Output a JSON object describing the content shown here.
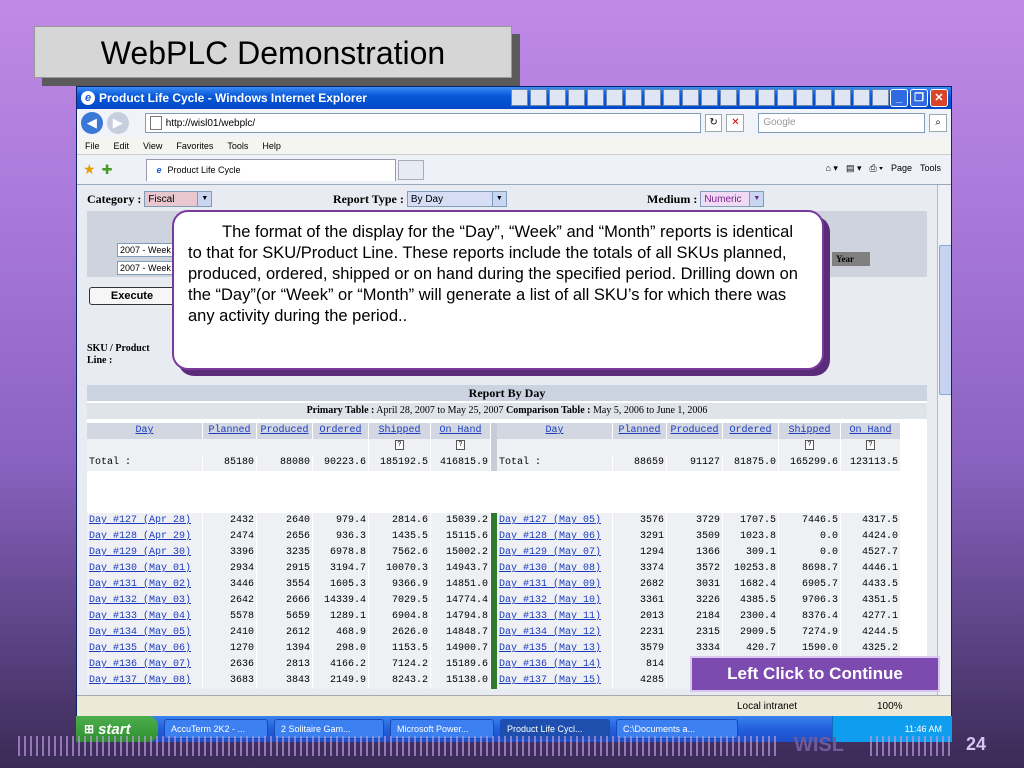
{
  "slide": {
    "title": "WebPLC Demonstration",
    "continue": "Left Click to Continue",
    "brand": "WISL",
    "page": "24"
  },
  "browser": {
    "title": "Product Life Cycle - Windows Internet Explorer",
    "url": "http://wisl01/webplc/",
    "search_placeholder": "Google",
    "menu": [
      "File",
      "Edit",
      "View",
      "Favorites",
      "Tools",
      "Help"
    ],
    "tab": "Product Life Cycle",
    "tools": [
      "Page",
      "Tools"
    ],
    "status_zone": "Local intranet",
    "zoom": "100%"
  },
  "filters": {
    "category_label": "Category :",
    "category_value": "Fiscal",
    "report_label": "Report Type :",
    "report_value": "By Day",
    "medium_label": "Medium :",
    "medium_value": "Numeric",
    "year_label": "Year",
    "week1": "2007 - Week 1",
    "week2": "2007 - Week 2",
    "execute": "Execute",
    "sku_label": "SKU / Product Line :"
  },
  "callout": "The format of the display for the “Day”, “Week” and “Month” reports is identical to that for SKU/Product Line. These reports include the totals of all SKUs planned, produced, ordered, shipped or on hand during the specified period. Drilling down on the “Day”(or “Week” or “Month” will generate a list of all SKU’s for which there was any activity during the period..",
  "report": {
    "title": "Report By Day",
    "primary_label": "Primary Table :",
    "primary_range": "April 28, 2007 to May 25, 2007",
    "comparison_label": "Comparison Table :",
    "comparison_range": "May 5, 2006 to June 1, 2006",
    "columns": [
      "Day",
      "Planned",
      "Produced",
      "Ordered",
      "Shipped",
      "On Hand"
    ],
    "total_left": [
      "Total :",
      "85180",
      "88080",
      "90223.6",
      "185192.5",
      "416815.9"
    ],
    "total_right": [
      "Total :",
      "88659",
      "91127",
      "81875.0",
      "165299.6",
      "123113.5"
    ],
    "rows": [
      [
        [
          "Day #127 (Apr 28)",
          "2432",
          "2640",
          "979.4",
          "2814.6",
          "15039.2"
        ],
        [
          "Day #127 (May 05)",
          "3576",
          "3729",
          "1707.5",
          "7446.5",
          "4317.5"
        ]
      ],
      [
        [
          "Day #128 (Apr 29)",
          "2474",
          "2656",
          "936.3",
          "1435.5",
          "15115.6"
        ],
        [
          "Day #128 (May 06)",
          "3291",
          "3509",
          "1023.8",
          "0.0",
          "4424.0"
        ]
      ],
      [
        [
          "Day #129 (Apr 30)",
          "3396",
          "3235",
          "6978.8",
          "7562.6",
          "15002.2"
        ],
        [
          "Day #129 (May 07)",
          "1294",
          "1366",
          "309.1",
          "0.0",
          "4527.7"
        ]
      ],
      [
        [
          "Day #130 (May 01)",
          "2934",
          "2915",
          "3194.7",
          "10070.3",
          "14943.7"
        ],
        [
          "Day #130 (May 08)",
          "3374",
          "3572",
          "10253.8",
          "8698.7",
          "4446.1"
        ]
      ],
      [
        [
          "Day #131 (May 02)",
          "3446",
          "3554",
          "1605.3",
          "9366.9",
          "14851.0"
        ],
        [
          "Day #131 (May 09)",
          "2682",
          "3031",
          "1682.4",
          "6905.7",
          "4433.5"
        ]
      ],
      [
        [
          "Day #132 (May 03)",
          "2642",
          "2666",
          "14339.4",
          "7029.5",
          "14774.4"
        ],
        [
          "Day #132 (May 10)",
          "3361",
          "3226",
          "4385.5",
          "9706.3",
          "4351.5"
        ]
      ],
      [
        [
          "Day #133 (May 04)",
          "5578",
          "5659",
          "1289.1",
          "6904.8",
          "14794.8"
        ],
        [
          "Day #133 (May 11)",
          "2013",
          "2184",
          "2300.4",
          "8376.4",
          "4277.1"
        ]
      ],
      [
        [
          "Day #134 (May 05)",
          "2410",
          "2612",
          "468.9",
          "2626.0",
          "14848.7"
        ],
        [
          "Day #134 (May 12)",
          "2231",
          "2315",
          "2909.5",
          "7274.9",
          "4244.5"
        ]
      ],
      [
        [
          "Day #135 (May 06)",
          "1270",
          "1394",
          "298.0",
          "1153.5",
          "14900.7"
        ],
        [
          "Day #135 (May 13)",
          "3579",
          "3334",
          "420.7",
          "1590.0",
          "4325.2"
        ]
      ],
      [
        [
          "Day #136 (May 07)",
          "2636",
          "2813",
          "4166.2",
          "7124.2",
          "15189.6"
        ],
        [
          "Day #136 (May 14)",
          "814",
          "",
          "",
          "",
          ""
        ]
      ],
      [
        [
          "Day #137 (May 08)",
          "3683",
          "3843",
          "2149.9",
          "8243.2",
          "15138.0"
        ],
        [
          "Day #137 (May 15)",
          "4285",
          "",
          "",
          "",
          ""
        ]
      ]
    ]
  },
  "taskbar": {
    "start": "start",
    "items": [
      "AccuTerm 2K2 - ...",
      "2 Solitaire Gam...",
      "Microsoft Power...",
      "Product Life Cycl...",
      "C:\\Documents a..."
    ],
    "clock": "11:46 AM"
  }
}
